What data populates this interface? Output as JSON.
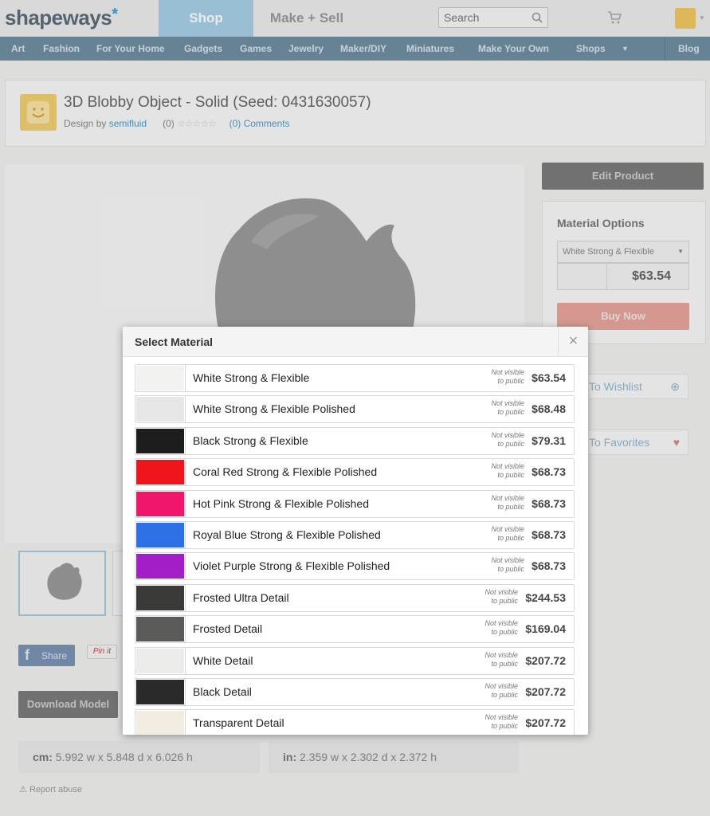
{
  "header": {
    "logo": "shapeways",
    "logo_star": "*",
    "tabs": [
      {
        "label": "Shop",
        "active": true
      },
      {
        "label": "Make + Sell",
        "active": false
      }
    ],
    "search_placeholder": "Search"
  },
  "categories": [
    "Art",
    "Fashion",
    "For Your Home",
    "Gadgets",
    "Games",
    "Jewelry",
    "Maker/DIY",
    "Miniatures",
    "Make Your Own",
    "Shops",
    "Blog"
  ],
  "product": {
    "title": "3D Blobby Object - Solid (Seed: 0431630057)",
    "design_by_label": "Design by",
    "designer": "semifluid",
    "rating_count": "(0)",
    "comments_link": "(0) Comments",
    "share_label": "Share",
    "pin_label": "Pin it",
    "download_label": "Download Model",
    "dims_cm_label": "cm:",
    "dims_cm": "5.992 w x 5.848 d x 6.026 h",
    "dims_in_label": "in:",
    "dims_in": "2.359 w x 2.302 d x 2.372 h",
    "report_label": "Report abuse"
  },
  "sidebar": {
    "edit_label": "Edit Product",
    "options_title": "Material Options",
    "selected_material": "White Strong & Flexible",
    "price": "$63.54",
    "buy_label": "Buy Now",
    "wishlist_label": "To Wishlist",
    "favorites_label": "To Favorites"
  },
  "modal": {
    "title": "Select Material",
    "close_icon": "×",
    "visibility_line1": "Not visible",
    "visibility_line2": "to public",
    "materials": [
      {
        "name": "White Strong & Flexible",
        "price": "$63.54",
        "swatch": "#f2f2f0"
      },
      {
        "name": "White Strong & Flexible Polished",
        "price": "$68.48",
        "swatch": "#e6e6e6"
      },
      {
        "name": "Black Strong & Flexible",
        "price": "$79.31",
        "swatch": "#1d1d1d"
      },
      {
        "name": "Coral Red Strong & Flexible Polished",
        "price": "$68.73",
        "swatch": "#f0141c"
      },
      {
        "name": "Hot Pink Strong & Flexible Polished",
        "price": "$68.73",
        "swatch": "#f0166a"
      },
      {
        "name": "Royal Blue Strong & Flexible Polished",
        "price": "$68.73",
        "swatch": "#2e6fe6"
      },
      {
        "name": "Violet Purple Strong & Flexible Polished",
        "price": "$68.73",
        "swatch": "#a41ec8"
      },
      {
        "name": "Frosted Ultra Detail",
        "price": "$244.53",
        "swatch": "#3a3a38"
      },
      {
        "name": "Frosted Detail",
        "price": "$169.04",
        "swatch": "#5a5a58"
      },
      {
        "name": "White Detail",
        "price": "$207.72",
        "swatch": "#ececea"
      },
      {
        "name": "Black Detail",
        "price": "$207.72",
        "swatch": "#2a2a2a"
      },
      {
        "name": "Transparent Detail",
        "price": "$207.72",
        "swatch": "#f3ece0"
      }
    ]
  },
  "colors": {
    "accent": "#a8cfe6",
    "nav_bar": "#6f8fa3",
    "link": "#4a9cc9",
    "buy": "#e7a59d"
  }
}
